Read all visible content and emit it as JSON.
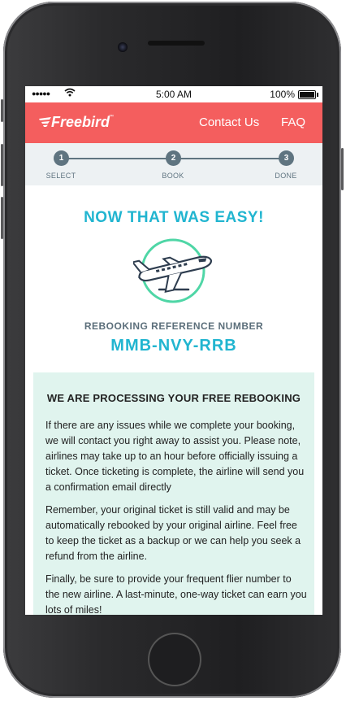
{
  "status_bar": {
    "signal": "●●●●●",
    "time": "5:00 AM",
    "battery_pct": "100%",
    "battery_level": 1.0
  },
  "header": {
    "logo": "Freebird",
    "logo_tm": "™",
    "nav": {
      "contact": "Contact Us",
      "faq": "FAQ"
    }
  },
  "steps": [
    {
      "number": "1",
      "label": "SELECT"
    },
    {
      "number": "2",
      "label": "BOOK"
    },
    {
      "number": "3",
      "label": "DONE"
    }
  ],
  "confirmation": {
    "title": "NOW THAT WAS EASY!",
    "ref_label": "REBOOKING REFERENCE NUMBER",
    "ref_number": "MMB-NVY-RRB"
  },
  "info": {
    "title": "WE ARE PROCESSING YOUR FREE REBOOKING",
    "paragraphs": [
      "If there are any issues while we complete your booking, we will contact you right away to assist you. Please note, airlines may take up to an hour before officially issuing a ticket. Once ticketing is complete, the airline will send you a confirmation email directly",
      "Remember, your original ticket is still valid and may be automatically rebooked by your original airline. Feel free to keep the ticket as a backup or we can help you seek a refund from the airline.",
      "Finally, be sure to provide your frequent flier number to the new airline. A last-minute, one-way ticket can earn you lots of miles!"
    ]
  },
  "colors": {
    "brand": "#f45e5e",
    "accent": "#21b5d0",
    "step": "#5f7480",
    "info_bg": "#e0f4ee",
    "plane_ring": "#4fd6a6"
  }
}
